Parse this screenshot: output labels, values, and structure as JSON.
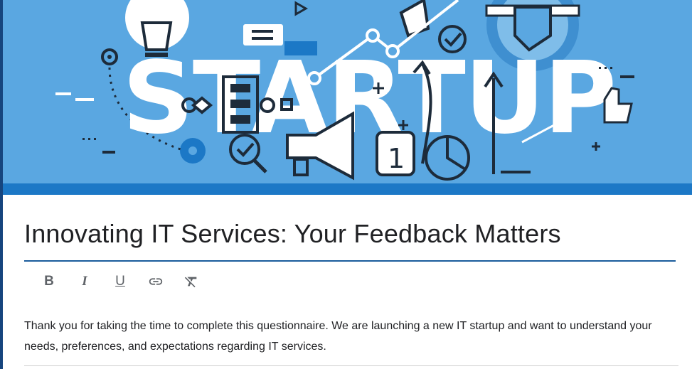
{
  "banner": {
    "word": "STARTUP",
    "sign_number": "1"
  },
  "form": {
    "title": "Innovating IT Services: Your Feedback Matters",
    "description": "Thank you for taking the time to complete this questionnaire. We are launching a new IT startup and want to understand your needs, preferences, and expectations regarding IT services."
  },
  "toolbar": {
    "bold_label": "B",
    "italic_label": "I",
    "underline_label": "U",
    "icons": [
      "link-icon",
      "clear-format-icon"
    ]
  },
  "colors": {
    "banner_bg": "#5aa7e1",
    "accent_blue": "#1c78c6",
    "title_underline": "#1a5c9c",
    "dark_frame": "#16457e"
  }
}
